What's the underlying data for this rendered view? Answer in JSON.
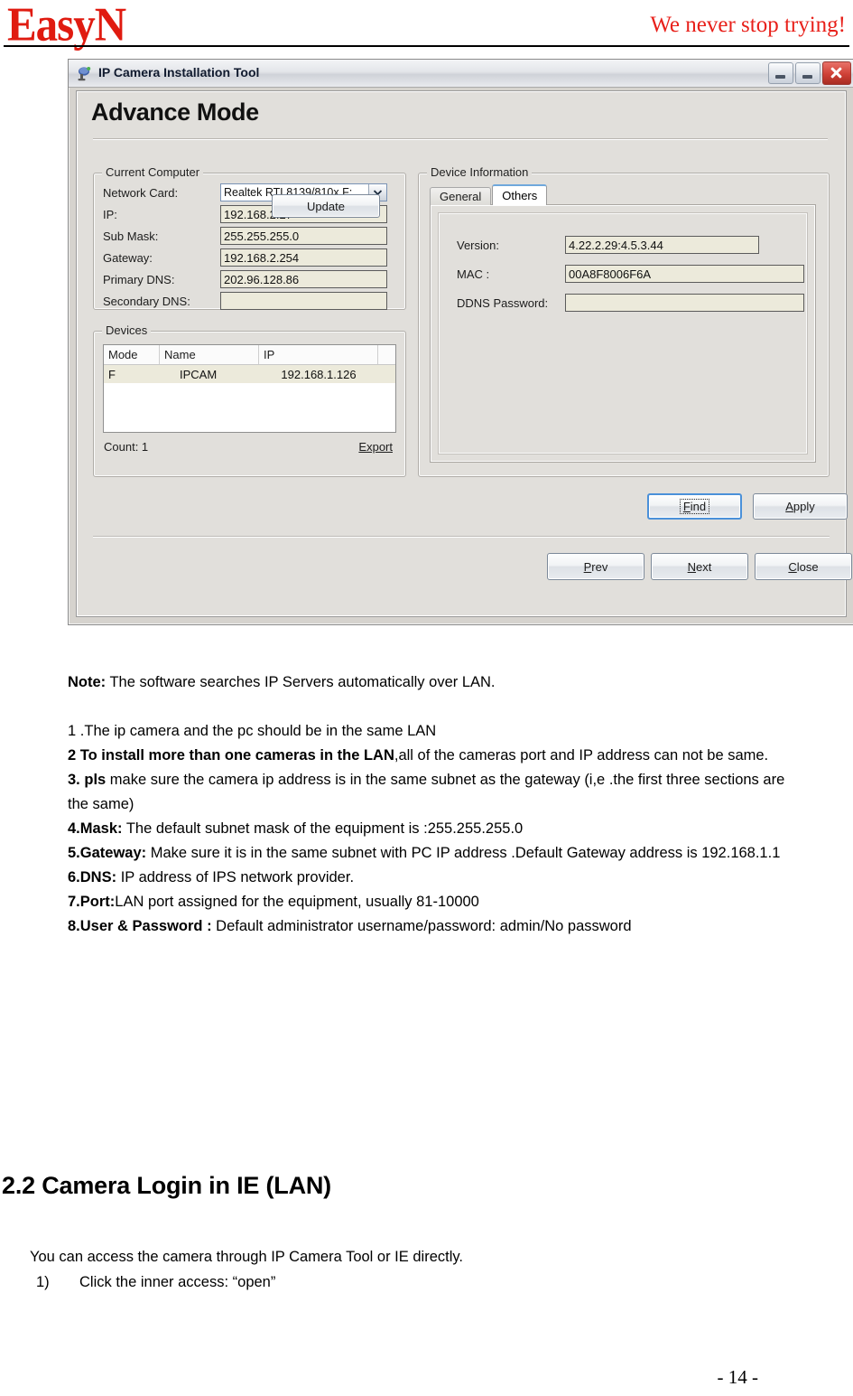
{
  "header": {
    "brand": "EasyN",
    "tagline": "We never stop trying!",
    "brand_color": "#e01b10"
  },
  "dialog": {
    "title": "IP Camera Installation Tool",
    "icon": "camera-icon",
    "mode_title": "Advance Mode",
    "titlebar_buttons": [
      "minimize",
      "minimize",
      "close"
    ],
    "current_computer": {
      "legend": "Current Computer",
      "fields": [
        {
          "label": "Network Card:",
          "value": "Realtek RTL8139/810x F;",
          "type": "select"
        },
        {
          "label": "IP:",
          "value": "192.168.2.27",
          "type": "text"
        },
        {
          "label": "Sub Mask:",
          "value": "255.255.255.0",
          "type": "text"
        },
        {
          "label": "Gateway:",
          "value": "192.168.2.254",
          "type": "text"
        },
        {
          "label": "Primary DNS:",
          "value": "202.96.128.86",
          "type": "text"
        },
        {
          "label": "Secondary DNS:",
          "value": "",
          "type": "text"
        }
      ],
      "update_label": "Update"
    },
    "devices": {
      "legend": "Devices",
      "columns": [
        "Mode",
        "Name",
        "IP",
        ""
      ],
      "rows": [
        {
          "mode": "F",
          "name": "IPCAM",
          "ip": "192.168.1.126"
        }
      ],
      "count_label": "Count: 1",
      "export_label": "Export"
    },
    "device_information": {
      "legend": "Device Information",
      "tabs": [
        {
          "label": "General",
          "active": false
        },
        {
          "label": "Others",
          "active": true
        }
      ],
      "fields": [
        {
          "label": "Version:",
          "value": "4.22.2.29:4.5.3.44"
        },
        {
          "label": "MAC  :",
          "value": "00A8F8006F6A"
        },
        {
          "label": "DDNS Password:",
          "value": ""
        }
      ]
    },
    "actions": {
      "find": {
        "label": "Find",
        "accel": "F",
        "focused": true
      },
      "apply": {
        "label": "Apply",
        "accel": "A"
      },
      "prev": {
        "label": "Prev",
        "accel": "P"
      },
      "next": {
        "label": "Next",
        "accel": "N"
      },
      "close": {
        "label": "Close",
        "accel": "C"
      }
    }
  },
  "notes": {
    "note_label": "Note:",
    "note_text": " The software searches IP Servers automatically over LAN.",
    "items": [
      {
        "num": "1 .",
        "bold": "",
        "text": "The ip camera and the pc should be in the same LAN",
        "num_bold": false
      },
      {
        "num": "2 ",
        "bold": "To install more than one cameras in the LAN",
        "text": ",all of the cameras port and IP address can not be same.",
        "num_bold": true
      },
      {
        "num": "3. ",
        "bold": "pls",
        "text": " make sure the camera ip address is in the same subnet as the gateway (i,e .the first three sections are the same)",
        "num_bold": true
      },
      {
        "num": "4.",
        "bold": "Mask:",
        "text": " The default subnet mask of the equipment is :255.255.255.0",
        "num_bold": true
      },
      {
        "num": "5.",
        "bold": "Gateway:",
        "text": " Make sure it is in the same subnet with PC IP address .Default Gateway address is 192.168.1.1",
        "num_bold": true
      },
      {
        "num": "6.",
        "bold": "DNS:",
        "text": " IP address of IPS network provider.",
        "num_bold": true
      },
      {
        "num": "7.",
        "bold": "Port:",
        "text": "LAN port assigned for the equipment, usually 81-10000",
        "num_bold": true
      },
      {
        "num": "8.",
        "bold": "User & Password :",
        "text": " Default administrator username/password: admin/No password",
        "num_bold": true
      }
    ]
  },
  "section": {
    "heading": "2.2 Camera Login in IE (LAN)",
    "paragraph": "You can access the camera through IP Camera Tool or IE directly.",
    "step_number": "1)",
    "step_text": "Click the inner access: “open”"
  },
  "footer": {
    "page_number": "- 14 -"
  }
}
